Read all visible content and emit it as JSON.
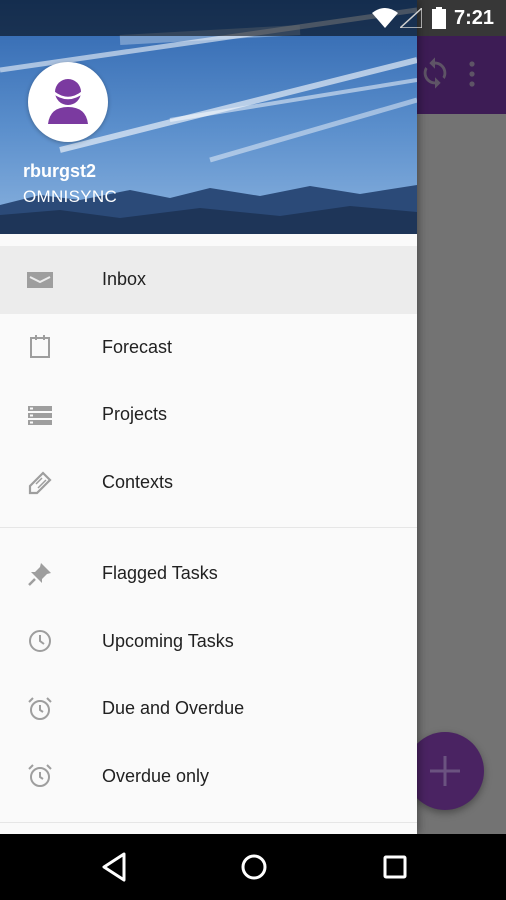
{
  "status_bar": {
    "time": "7:21"
  },
  "user": {
    "name": "rburgst2",
    "account": "OMNISYNC"
  },
  "menu": {
    "primary": [
      {
        "label": "Inbox",
        "icon": "inbox-icon"
      },
      {
        "label": "Forecast",
        "icon": "calendar-icon"
      },
      {
        "label": "Projects",
        "icon": "projects-icon"
      },
      {
        "label": "Contexts",
        "icon": "tag-icon"
      }
    ],
    "secondary": [
      {
        "label": "Flagged Tasks",
        "icon": "pin-icon"
      },
      {
        "label": "Upcoming Tasks",
        "icon": "clock-icon"
      },
      {
        "label": "Due and Overdue",
        "icon": "alarm-icon"
      },
      {
        "label": "Overdue only",
        "icon": "alarm-icon"
      }
    ]
  },
  "colors": {
    "accent": "#4a2362",
    "toolbar": "#3d1c55",
    "active_row": "#ececec"
  }
}
